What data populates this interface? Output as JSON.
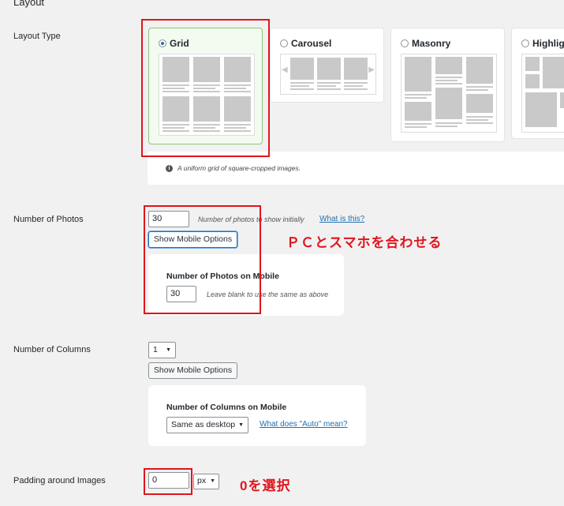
{
  "section": {
    "title": "Layout"
  },
  "layout_type": {
    "label": "Layout Type",
    "options": [
      {
        "name": "Grid",
        "selected": true
      },
      {
        "name": "Carousel",
        "selected": false
      },
      {
        "name": "Masonry",
        "selected": false
      },
      {
        "name": "Highlight",
        "selected": false
      }
    ],
    "description": "A uniform grid of square-cropped images.",
    "info_glyph": "i"
  },
  "number_of_photos": {
    "label": "Number of Photos",
    "value": "30",
    "hint": "Number of photos to show initially",
    "help_link": "What is this?",
    "mobile_button": "Show Mobile Options",
    "mobile": {
      "title": "Number of Photos on Mobile",
      "value": "30",
      "hint": "Leave blank to use the same as above"
    }
  },
  "number_of_columns": {
    "label": "Number of Columns",
    "value": "1",
    "mobile_button": "Show Mobile Options",
    "mobile": {
      "title": "Number of Columns on Mobile",
      "selected": "Same as desktop",
      "help_link": "What does \"Auto\" mean?"
    }
  },
  "padding": {
    "label": "Padding around Images",
    "value": "0",
    "unit": "px"
  },
  "annotations": {
    "photos_note": "ＰＣとスマホを合わせる",
    "padding_note": "0を選択"
  },
  "colors": {
    "accent": "#2271b1",
    "annotation": "#e0151d",
    "selected_bg": "#f3faf0",
    "selected_border": "#8dc57d"
  }
}
